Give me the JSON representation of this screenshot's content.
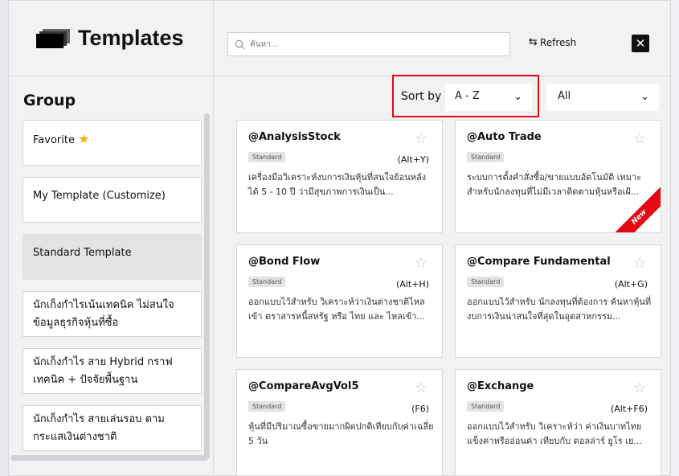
{
  "brand": {
    "title": "Templates",
    "icon": "templates-stack-icon"
  },
  "search": {
    "placeholder": "ค้นหา..."
  },
  "toolbar": {
    "refresh_label": "Refresh",
    "close_label": "✕"
  },
  "group": {
    "title": "Group",
    "items": [
      {
        "label": "Favorite",
        "icon": "star-icon",
        "active": false
      },
      {
        "label": "My Template (Customize)",
        "active": false
      },
      {
        "label": "Standard Template",
        "active": true
      },
      {
        "label": "นักเก็งกำไรเน้นเทคนิค ไม่สนใจ ข้อมูลธุรกิจหุ้นที่ซื้อ",
        "active": false
      },
      {
        "label": "นักเก็งกำไร สาย Hybrid กราฟ เทคนิค + ปัจจัยพื้นฐาน",
        "active": false
      },
      {
        "label": "นักเก็งกำไร สายเล่นรอบ ตาม กระแสเงินต่างชาติ",
        "active": false
      }
    ]
  },
  "sort": {
    "label": "Sort by",
    "value": "A - Z"
  },
  "filter": {
    "value": "All"
  },
  "cards": [
    {
      "title": "@AnalysisStock",
      "badge": "Standard",
      "shortcut": "(Alt+Y)",
      "desc": "เครื่องมือวิเคราะห์งบการเงินหุ้นที่สนใจย้อนหลังได้ 5 - 10 ปี ว่ามีสุขภาพการเงินเป็น..."
    },
    {
      "title": "@Auto Trade",
      "badge": "Standard",
      "shortcut": "",
      "desc": "ระบบการตั้งคำสั่งซื้อ/ขายแบบอัตโนมัติ เหมาะสำหรับนักลงทุนที่ไม่มีเวลาติดตามหุ้นหรือเฝ้...",
      "ribbon": "New"
    },
    {
      "title": "@Bond Flow",
      "badge": "Standard",
      "shortcut": "(Alt+H)",
      "desc": "ออกแบบไว้สำหรับ วิเคราะห์ว่าเงินต่างชาติไหลเข้า ตราสารหนี้สหรัฐ หรือ ไทย และ ไหลเข้า..."
    },
    {
      "title": "@Compare Fundamental",
      "badge": "Standard",
      "shortcut": "(Alt+G)",
      "desc": "ออกแบบไว้สำหรับ นักลงทุนที่ต้องการ ค้นหาหุ้นที่งบการเงินน่าสนใจที่สุดในอุตสาหกรรม..."
    },
    {
      "title": "@CompareAvgVol5",
      "badge": "Standard",
      "shortcut": "(F6)",
      "desc": "หุ้นที่มีปริมาณซื้อขายมากผิดปกติเทียบกับค่าเฉลี่ย 5 วัน"
    },
    {
      "title": "@Exchange",
      "badge": "Standard",
      "shortcut": "(Alt+F6)",
      "desc": "ออกแบบไว้สำหรับ วิเคราะห์ว่า ค่าเงินบาทไทยแข็งค่าหรืออ่อนค่า เทียบกับ ดอลล่าร์ ยูโร เย..."
    }
  ],
  "colors": {
    "accent_red": "#e50914",
    "favorite_star": "#f5b400"
  }
}
